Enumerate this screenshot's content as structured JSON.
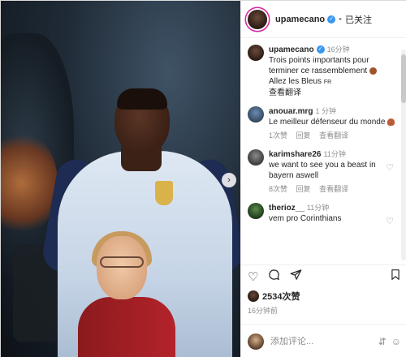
{
  "header": {
    "username": "upamecano",
    "separator": "•",
    "follow_status": "已关注"
  },
  "caption": {
    "username": "upamecano",
    "time": "16分钟",
    "text": "Trois points importants pour terminer ce rassemblement",
    "text2": "Allez les Bleus",
    "flag": "FR"
  },
  "comments": [
    {
      "username": "anouar.mrg",
      "time": "1 分钟",
      "text": "Le meilleur défenseur du monde",
      "likes": "1次赞",
      "reply": "回复",
      "translate": "查看翻译"
    },
    {
      "username": "karimshare26",
      "time": "11分钟",
      "text": "we want to see you a beast in bayern aswell",
      "likes": "8次赞",
      "reply": "回复",
      "translate": "查看翻译"
    },
    {
      "username": "therioz__",
      "time": "11分钟",
      "text": "vem pro Corinthians",
      "likes": "",
      "reply": "",
      "translate": ""
    }
  ],
  "caption_translate": "查看翻译",
  "stats": {
    "likes": "2534次赞",
    "posted": "16分钟前"
  },
  "composer": {
    "placeholder": "添加评论..."
  },
  "icons": {
    "heart": "heart-icon",
    "comment": "comment-icon",
    "share": "share-icon",
    "save": "bookmark-icon",
    "emoji": "emoji-icon",
    "next": "chevron-right-icon"
  },
  "colors": {
    "verified": "#3897f0",
    "story_ring": "#d6249f",
    "muted": "#8e8e8e"
  }
}
